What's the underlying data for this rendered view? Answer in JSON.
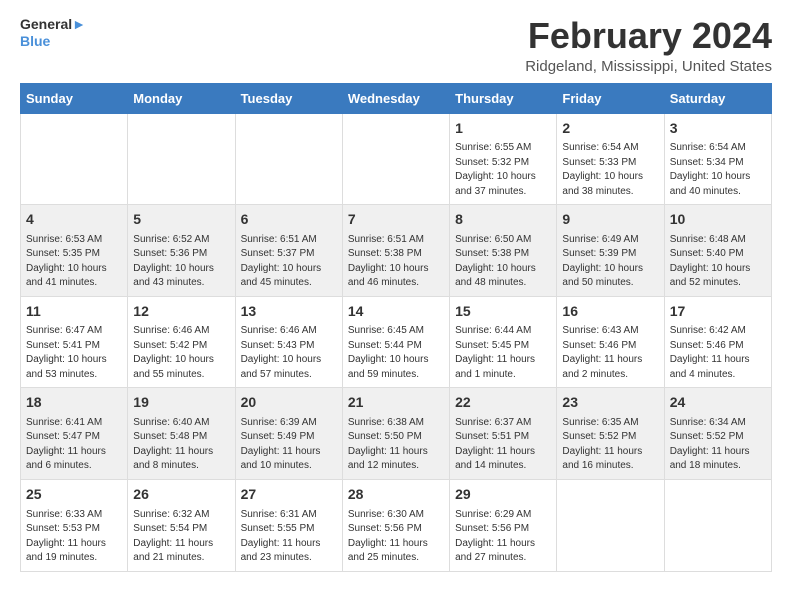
{
  "header": {
    "logo_line1": "General",
    "logo_line2": "Blue",
    "title": "February 2024",
    "subtitle": "Ridgeland, Mississippi, United States"
  },
  "days_of_week": [
    "Sunday",
    "Monday",
    "Tuesday",
    "Wednesday",
    "Thursday",
    "Friday",
    "Saturday"
  ],
  "weeks": [
    [
      {
        "day": "",
        "info": ""
      },
      {
        "day": "",
        "info": ""
      },
      {
        "day": "",
        "info": ""
      },
      {
        "day": "",
        "info": ""
      },
      {
        "day": "1",
        "info": "Sunrise: 6:55 AM\nSunset: 5:32 PM\nDaylight: 10 hours\nand 37 minutes."
      },
      {
        "day": "2",
        "info": "Sunrise: 6:54 AM\nSunset: 5:33 PM\nDaylight: 10 hours\nand 38 minutes."
      },
      {
        "day": "3",
        "info": "Sunrise: 6:54 AM\nSunset: 5:34 PM\nDaylight: 10 hours\nand 40 minutes."
      }
    ],
    [
      {
        "day": "4",
        "info": "Sunrise: 6:53 AM\nSunset: 5:35 PM\nDaylight: 10 hours\nand 41 minutes."
      },
      {
        "day": "5",
        "info": "Sunrise: 6:52 AM\nSunset: 5:36 PM\nDaylight: 10 hours\nand 43 minutes."
      },
      {
        "day": "6",
        "info": "Sunrise: 6:51 AM\nSunset: 5:37 PM\nDaylight: 10 hours\nand 45 minutes."
      },
      {
        "day": "7",
        "info": "Sunrise: 6:51 AM\nSunset: 5:38 PM\nDaylight: 10 hours\nand 46 minutes."
      },
      {
        "day": "8",
        "info": "Sunrise: 6:50 AM\nSunset: 5:38 PM\nDaylight: 10 hours\nand 48 minutes."
      },
      {
        "day": "9",
        "info": "Sunrise: 6:49 AM\nSunset: 5:39 PM\nDaylight: 10 hours\nand 50 minutes."
      },
      {
        "day": "10",
        "info": "Sunrise: 6:48 AM\nSunset: 5:40 PM\nDaylight: 10 hours\nand 52 minutes."
      }
    ],
    [
      {
        "day": "11",
        "info": "Sunrise: 6:47 AM\nSunset: 5:41 PM\nDaylight: 10 hours\nand 53 minutes."
      },
      {
        "day": "12",
        "info": "Sunrise: 6:46 AM\nSunset: 5:42 PM\nDaylight: 10 hours\nand 55 minutes."
      },
      {
        "day": "13",
        "info": "Sunrise: 6:46 AM\nSunset: 5:43 PM\nDaylight: 10 hours\nand 57 minutes."
      },
      {
        "day": "14",
        "info": "Sunrise: 6:45 AM\nSunset: 5:44 PM\nDaylight: 10 hours\nand 59 minutes."
      },
      {
        "day": "15",
        "info": "Sunrise: 6:44 AM\nSunset: 5:45 PM\nDaylight: 11 hours\nand 1 minute."
      },
      {
        "day": "16",
        "info": "Sunrise: 6:43 AM\nSunset: 5:46 PM\nDaylight: 11 hours\nand 2 minutes."
      },
      {
        "day": "17",
        "info": "Sunrise: 6:42 AM\nSunset: 5:46 PM\nDaylight: 11 hours\nand 4 minutes."
      }
    ],
    [
      {
        "day": "18",
        "info": "Sunrise: 6:41 AM\nSunset: 5:47 PM\nDaylight: 11 hours\nand 6 minutes."
      },
      {
        "day": "19",
        "info": "Sunrise: 6:40 AM\nSunset: 5:48 PM\nDaylight: 11 hours\nand 8 minutes."
      },
      {
        "day": "20",
        "info": "Sunrise: 6:39 AM\nSunset: 5:49 PM\nDaylight: 11 hours\nand 10 minutes."
      },
      {
        "day": "21",
        "info": "Sunrise: 6:38 AM\nSunset: 5:50 PM\nDaylight: 11 hours\nand 12 minutes."
      },
      {
        "day": "22",
        "info": "Sunrise: 6:37 AM\nSunset: 5:51 PM\nDaylight: 11 hours\nand 14 minutes."
      },
      {
        "day": "23",
        "info": "Sunrise: 6:35 AM\nSunset: 5:52 PM\nDaylight: 11 hours\nand 16 minutes."
      },
      {
        "day": "24",
        "info": "Sunrise: 6:34 AM\nSunset: 5:52 PM\nDaylight: 11 hours\nand 18 minutes."
      }
    ],
    [
      {
        "day": "25",
        "info": "Sunrise: 6:33 AM\nSunset: 5:53 PM\nDaylight: 11 hours\nand 19 minutes."
      },
      {
        "day": "26",
        "info": "Sunrise: 6:32 AM\nSunset: 5:54 PM\nDaylight: 11 hours\nand 21 minutes."
      },
      {
        "day": "27",
        "info": "Sunrise: 6:31 AM\nSunset: 5:55 PM\nDaylight: 11 hours\nand 23 minutes."
      },
      {
        "day": "28",
        "info": "Sunrise: 6:30 AM\nSunset: 5:56 PM\nDaylight: 11 hours\nand 25 minutes."
      },
      {
        "day": "29",
        "info": "Sunrise: 6:29 AM\nSunset: 5:56 PM\nDaylight: 11 hours\nand 27 minutes."
      },
      {
        "day": "",
        "info": ""
      },
      {
        "day": "",
        "info": ""
      }
    ]
  ]
}
